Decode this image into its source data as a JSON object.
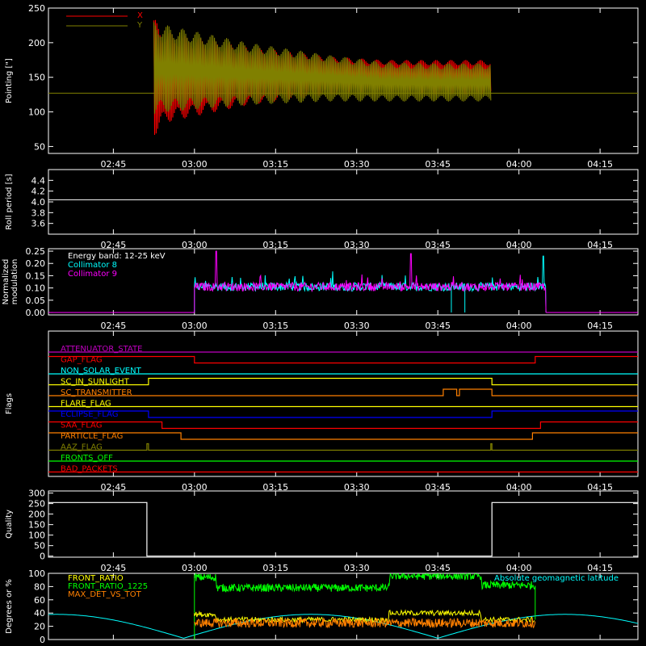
{
  "xaxis": {
    "ticks": [
      "02:45",
      "03:00",
      "03:15",
      "03:30",
      "03:45",
      "04:00",
      "04:15"
    ],
    "tick_minutes": [
      165,
      180,
      195,
      210,
      225,
      240,
      255
    ],
    "range_minutes": [
      153,
      262
    ]
  },
  "colors": {
    "red": "#ff0000",
    "olive": "#808000",
    "cyan": "#00ffff",
    "magenta": "#ff00ff",
    "white": "#ffffff",
    "green": "#00ff00",
    "yellow": "#ffff00",
    "orange": "#ff8000",
    "blue": "#0000ff",
    "purple": "#c000c0"
  },
  "chart_data": [
    {
      "id": "pointing",
      "type": "line",
      "ylabel": "Pointing [\"]",
      "ylim": [
        40,
        250
      ],
      "yticks": [
        50,
        100,
        150,
        200,
        250
      ],
      "series": [
        {
          "name": "X",
          "color": "#ff0000",
          "envelope": [
            [
              171,
              127,
              127
            ],
            [
              172.5,
              65,
              235
            ],
            [
              175,
              85,
              215
            ],
            [
              190,
              110,
              195
            ],
            [
              205,
              125,
              180
            ],
            [
              215,
              130,
              175
            ],
            [
              225,
              125,
              175
            ],
            [
              234.8,
              125,
              175
            ]
          ]
        },
        {
          "name": "Y",
          "color": "#808000",
          "envelope": [
            [
              171,
              127,
              127
            ],
            [
              172.5,
              95,
              230
            ],
            [
              175,
              100,
              225
            ],
            [
              190,
              110,
              200
            ],
            [
              205,
              115,
              182
            ],
            [
              215,
              115,
              172
            ],
            [
              225,
              115,
              170
            ],
            [
              234.8,
              115,
              170
            ]
          ]
        }
      ],
      "baseline": 127
    },
    {
      "id": "roll",
      "type": "line",
      "ylabel": "Roll period [s]",
      "ylim": [
        3.4,
        4.6
      ],
      "yticks": [
        3.6,
        3.8,
        4.0,
        4.2,
        4.4
      ],
      "ytick_labels": [
        "3.6",
        "3.8",
        "4.0",
        "4.2",
        "4.4"
      ],
      "value": 4.04
    },
    {
      "id": "modulation",
      "type": "line",
      "ylabel": "Normalized modulation",
      "ylim": [
        -0.01,
        0.26
      ],
      "yticks": [
        0.0,
        0.05,
        0.1,
        0.15,
        0.2,
        0.25
      ],
      "ytick_labels": [
        "0.00",
        "0.05",
        "0.10",
        "0.15",
        "0.20",
        "0.25"
      ],
      "legend": [
        {
          "label": "Energy band: 12-25 keV",
          "color": "#ffffff"
        },
        {
          "label": "Collimator 8",
          "color": "#00ffff"
        },
        {
          "label": "Collimator 9",
          "color": "#ff00ff"
        }
      ],
      "active_range": [
        180,
        245
      ],
      "mean": 0.105
    },
    {
      "id": "flags",
      "type": "step",
      "ylabel": "Flags",
      "flags": [
        {
          "label": "ATTENUATOR_STATE",
          "color": "#c000c0",
          "steps": [
            [
              153,
              0
            ],
            [
              262,
              0
            ]
          ]
        },
        {
          "label": "GAP_FLAG",
          "color": "#ff0000",
          "steps": [
            [
              153,
              1
            ],
            [
              180,
              0
            ],
            [
              243,
              1
            ]
          ]
        },
        {
          "label": "NON_SOLAR_EVENT",
          "color": "#00ffff",
          "steps": [
            [
              153,
              0
            ]
          ]
        },
        {
          "label": "SC_IN_SUNLIGHT",
          "color": "#ffff00",
          "steps": [
            [
              153,
              0
            ],
            [
              171.5,
              1
            ],
            [
              235,
              0
            ]
          ]
        },
        {
          "label": "SC_TRANSMITTER",
          "color": "#ff8000",
          "steps": [
            [
              153,
              0
            ],
            [
              226,
              1
            ],
            [
              228.5,
              0
            ],
            [
              229,
              1
            ],
            [
              235,
              0
            ]
          ]
        },
        {
          "label": "FLARE_FLAG",
          "color": "#ffff00",
          "steps": [
            [
              153,
              0
            ]
          ]
        },
        {
          "label": "ECLIPSE_FLAG",
          "color": "#0000ff",
          "steps": [
            [
              153,
              1
            ],
            [
              171.5,
              0
            ],
            [
              235,
              1
            ]
          ]
        },
        {
          "label": "SAA_FLAG",
          "color": "#ff0000",
          "steps": [
            [
              153,
              1
            ],
            [
              174,
              0
            ],
            [
              244,
              1
            ]
          ]
        },
        {
          "label": "PARTICLE_FLAG",
          "color": "#ff8000",
          "steps": [
            [
              153,
              1
            ],
            [
              177.5,
              0
            ],
            [
              242.5,
              1
            ]
          ]
        },
        {
          "label": "AAZ_FLAG",
          "color": "#808000",
          "steps": [
            [
              153,
              0
            ],
            [
              171.2,
              1
            ],
            [
              171.5,
              0
            ],
            [
              234.8,
              1
            ],
            [
              235,
              0
            ]
          ]
        },
        {
          "label": "FRONTS_OFF",
          "color": "#00ff00",
          "steps": [
            [
              153,
              0
            ]
          ]
        },
        {
          "label": "BAD_PACKETS",
          "color": "#ff0000",
          "steps": [
            [
              153,
              0
            ]
          ]
        }
      ]
    },
    {
      "id": "quality",
      "type": "step",
      "ylabel": "Quality",
      "ylim": [
        -5,
        310
      ],
      "yticks": [
        0,
        50,
        100,
        150,
        200,
        250,
        300
      ],
      "steps": [
        [
          153,
          255
        ],
        [
          171.2,
          0
        ],
        [
          235,
          255
        ]
      ]
    },
    {
      "id": "ratios",
      "type": "line",
      "ylabel": "Degrees or %",
      "ylim": [
        0,
        100
      ],
      "yticks": [
        0,
        20,
        40,
        60,
        80,
        100
      ],
      "legend": [
        {
          "label": "FRONT_RATIO",
          "color": "#ffff00"
        },
        {
          "label": "FRONT_RATIO_1225",
          "color": "#00ff00"
        },
        {
          "label": "MAX_DET_VS_TOT",
          "color": "#ff8000"
        }
      ],
      "right_label": {
        "label": "Absolute geomagnetic latitude",
        "color": "#00ffff"
      },
      "active_range": [
        180,
        243
      ]
    }
  ]
}
